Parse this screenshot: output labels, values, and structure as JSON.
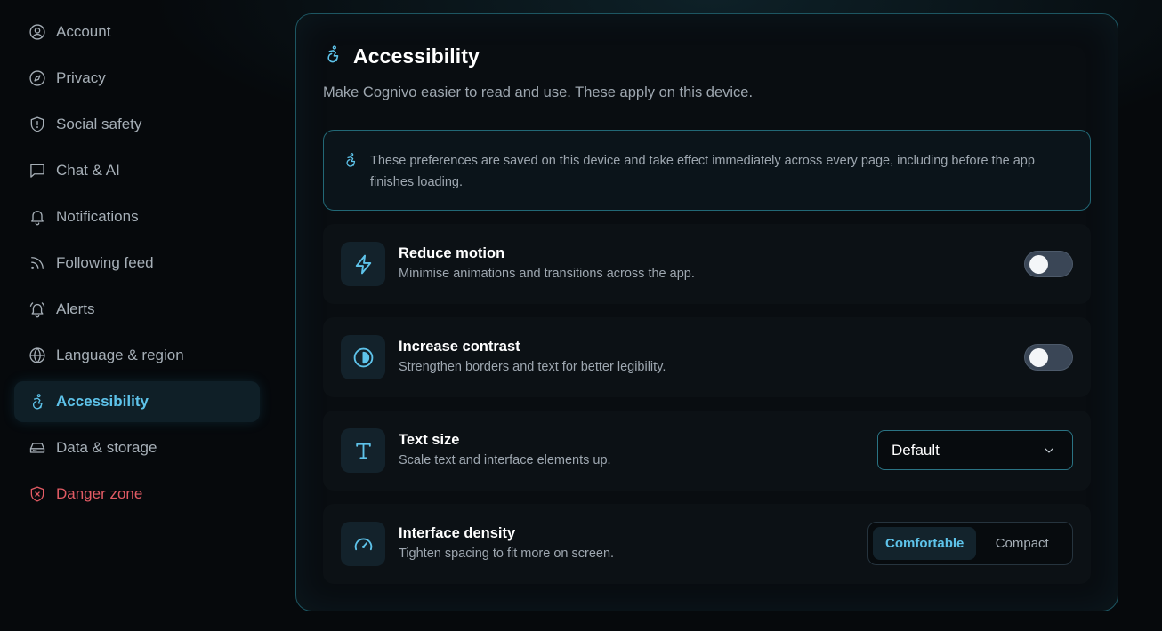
{
  "sidebar": {
    "items": [
      {
        "label": "Account",
        "icon": "user-circle-icon"
      },
      {
        "label": "Privacy",
        "icon": "compass-icon"
      },
      {
        "label": "Social safety",
        "icon": "shield-icon"
      },
      {
        "label": "Chat & AI",
        "icon": "chat-bubble-icon"
      },
      {
        "label": "Notifications",
        "icon": "bell-icon"
      },
      {
        "label": "Following feed",
        "icon": "rss-icon"
      },
      {
        "label": "Alerts",
        "icon": "bell-ring-icon"
      },
      {
        "label": "Language & region",
        "icon": "globe-icon"
      },
      {
        "label": "Accessibility",
        "icon": "accessibility-icon",
        "active": true
      },
      {
        "label": "Data & storage",
        "icon": "hard-drive-icon"
      },
      {
        "label": "Danger zone",
        "icon": "shield-x-icon",
        "danger": true
      }
    ]
  },
  "panel": {
    "title": "Accessibility",
    "subtitle": "Make Cognivo easier to read and use. These apply on this device.",
    "info": "These preferences are saved on this device and take effect immediately across every page, including before the app finishes loading."
  },
  "settings": {
    "reduce_motion": {
      "title": "Reduce motion",
      "description": "Minimise animations and transitions across the app.",
      "enabled": false,
      "icon": "lightning-icon"
    },
    "increase_contrast": {
      "title": "Increase contrast",
      "description": "Strengthen borders and text for better legibility.",
      "enabled": false,
      "icon": "contrast-icon"
    },
    "text_size": {
      "title": "Text size",
      "description": "Scale text and interface elements up.",
      "value": "Default",
      "icon": "type-icon"
    },
    "density": {
      "title": "Interface density",
      "description": "Tighten spacing to fit more on screen.",
      "options": [
        "Comfortable",
        "Compact"
      ],
      "selected": "Comfortable",
      "icon": "gauge-icon"
    }
  },
  "colors": {
    "accent": "#5ec3ea",
    "danger": "#e25b64",
    "panel_border": "#1d5662",
    "background": "#06090c"
  }
}
